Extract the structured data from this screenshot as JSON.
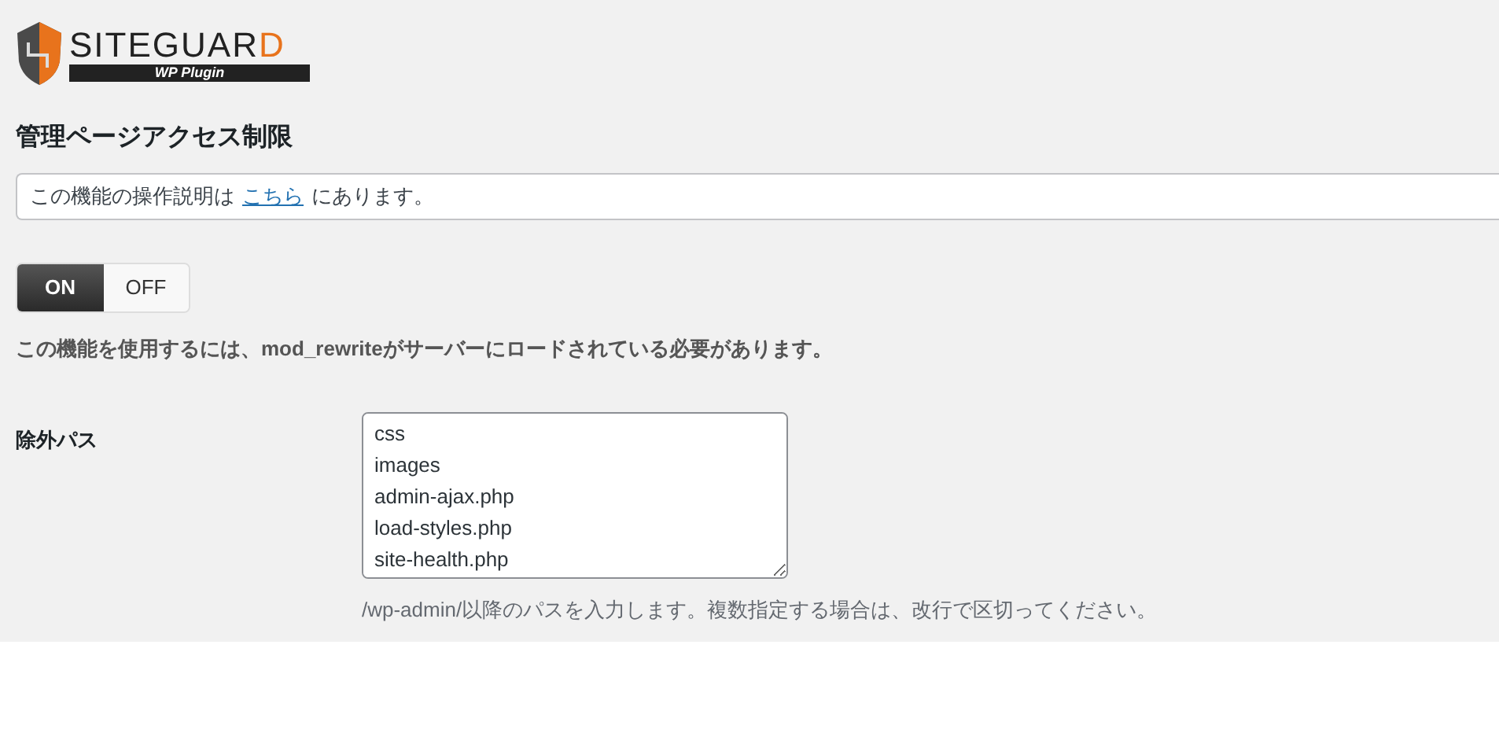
{
  "logo": {
    "name": "SITEGUAR",
    "name_accent": "D",
    "tagline": "WP Plugin"
  },
  "title": "管理ページアクセス制限",
  "info": {
    "before": "この機能の操作説明は",
    "link": "こちら",
    "after": "にあります。"
  },
  "toggle": [
    {
      "label": "ON",
      "selected": true
    },
    {
      "label": "OFF",
      "selected": false
    }
  ],
  "note": "この機能を使用するには、mod_rewriteがサーバーにロードされている必要があります。",
  "exclude_paths": {
    "label": "除外パス",
    "lines": [
      "css",
      "images",
      "admin-ajax.php",
      "load-styles.php",
      "site-health.php"
    ],
    "help": "/wp-admin/以降のパスを入力します。複数指定する場合は、改行で区切ってください。"
  }
}
